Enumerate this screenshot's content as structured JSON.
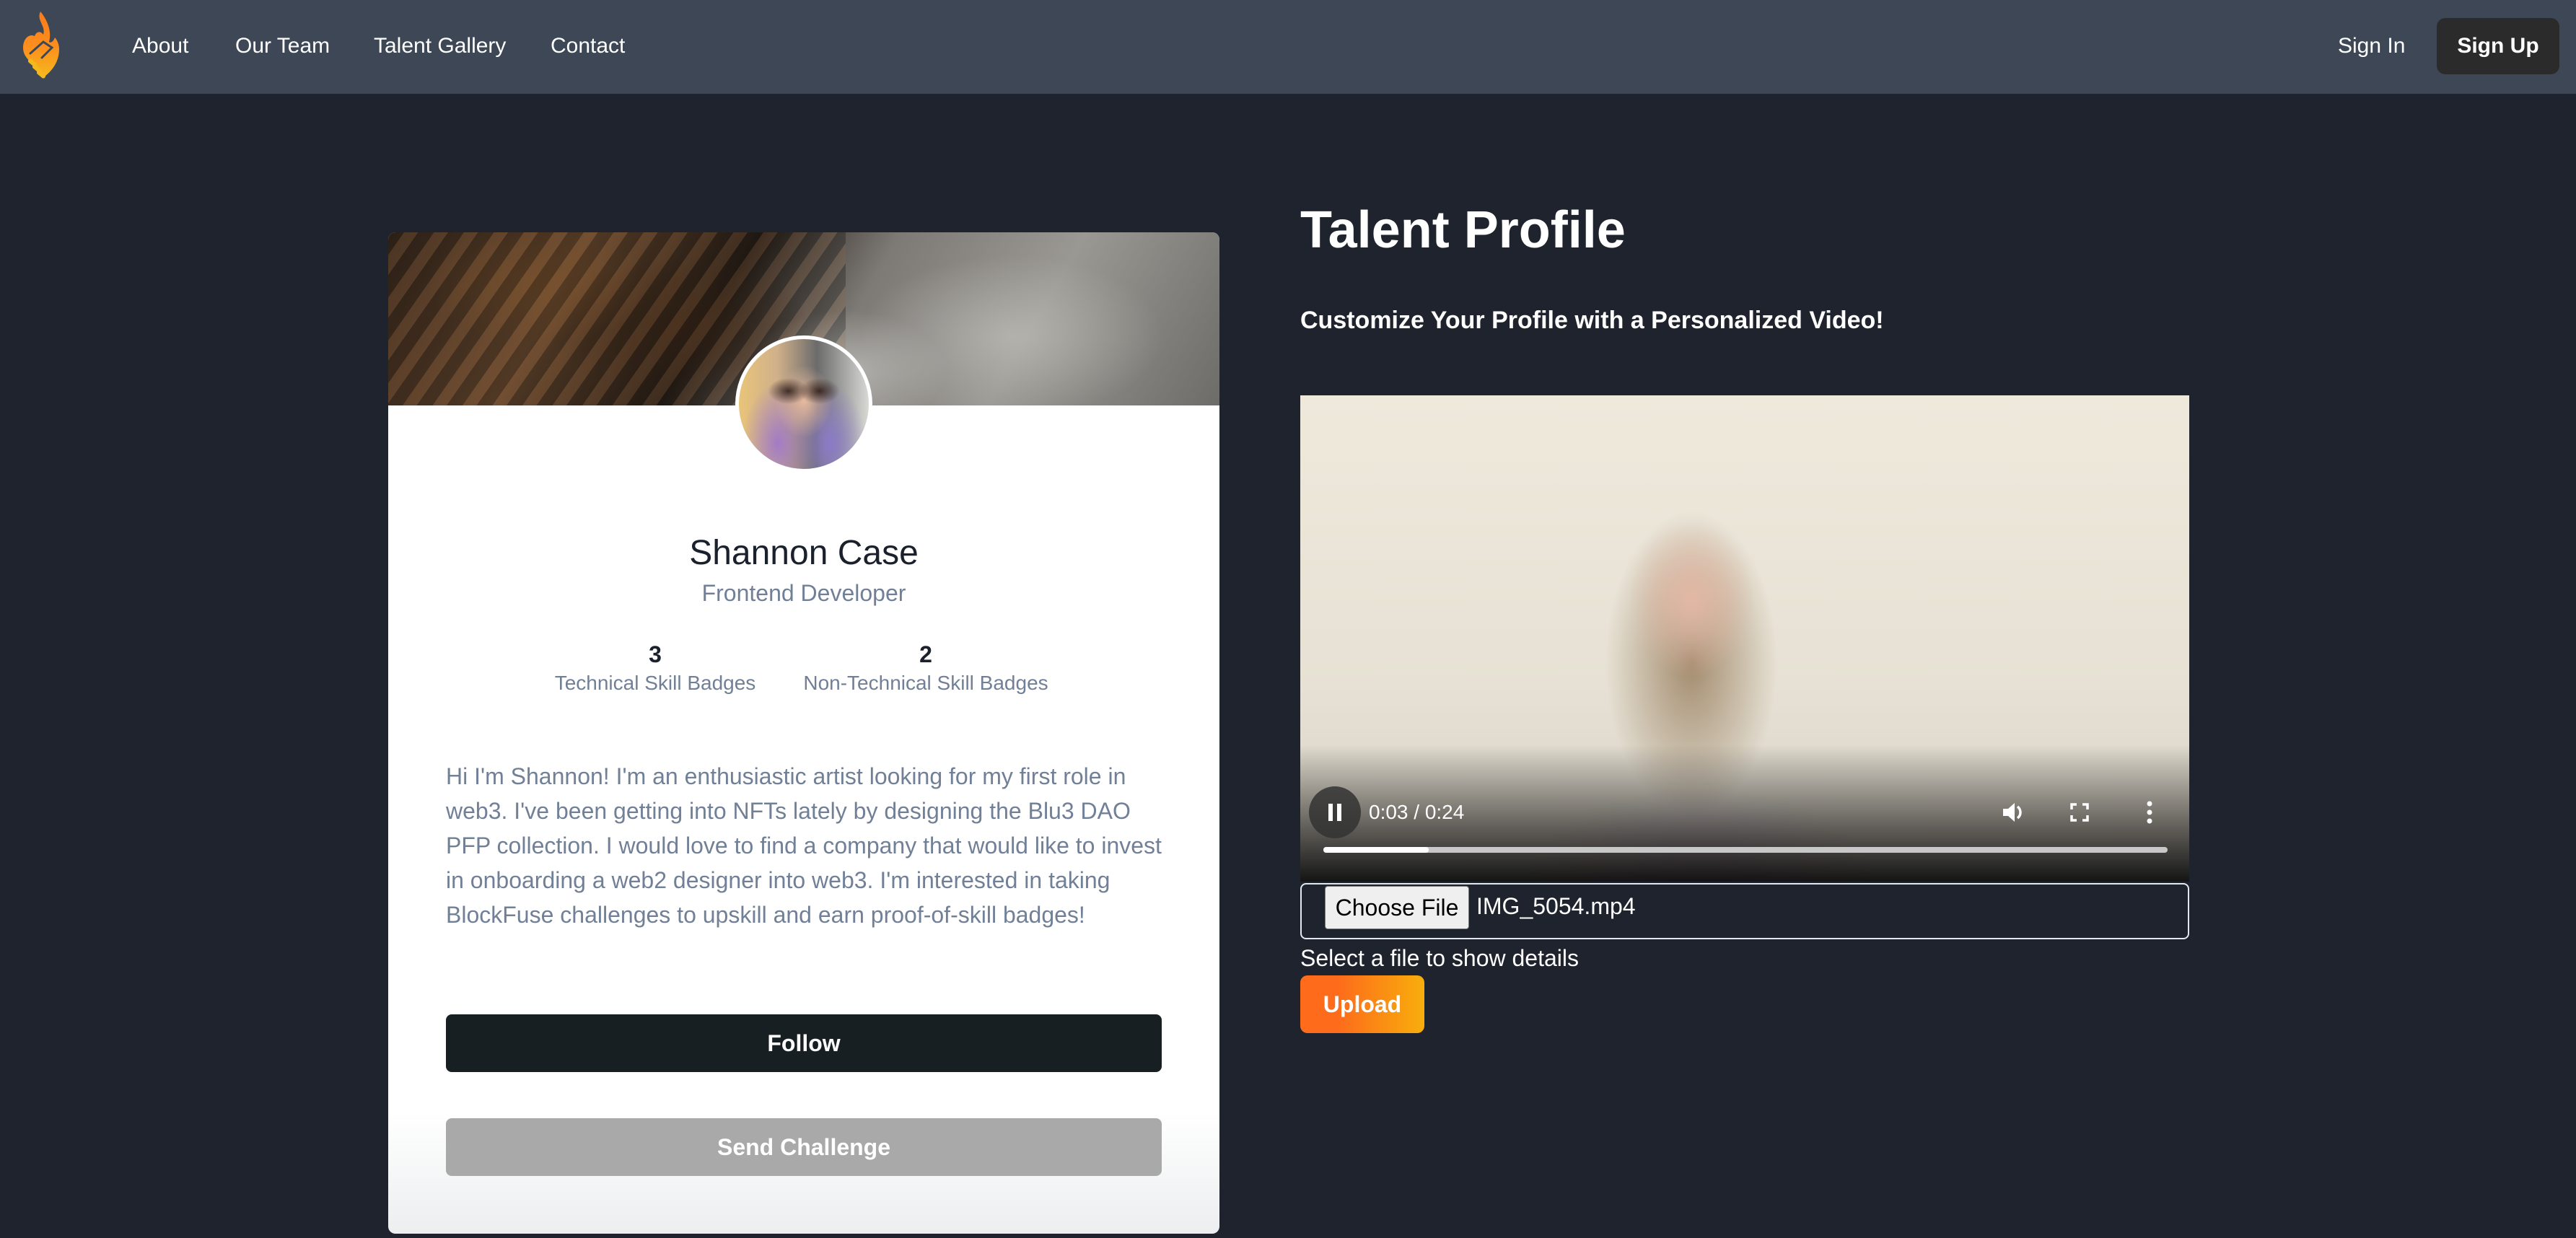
{
  "navbar": {
    "logo_icon": "flame-handshake-logo-icon",
    "links": [
      "About",
      "Our Team",
      "Talent Gallery",
      "Contact"
    ],
    "sign_in": "Sign In",
    "sign_up": "Sign Up"
  },
  "profile": {
    "name": "Shannon Case",
    "role": "Frontend Developer",
    "stats": [
      {
        "count": "3",
        "label": "Technical Skill Badges"
      },
      {
        "count": "2",
        "label": "Non-Technical Skill Badges"
      }
    ],
    "bio": "Hi I'm Shannon! I'm an enthusiastic artist looking for my first role in web3. I've been getting into NFTs lately by designing the Blu3 DAO PFP collection. I would love to find a company that would like to invest in onboarding a web2 designer into web3. I'm interested in taking BlockFuse challenges to upskill and earn proof-of-skill badges!",
    "follow_label": "Follow",
    "challenge_label": "Send Challenge"
  },
  "main": {
    "title": "Talent Profile",
    "subtitle": "Customize Your Profile with a Personalized Video!",
    "video": {
      "state": "playing",
      "current_time": "0:03",
      "duration": "0:24",
      "time_display": "0:03 / 0:24",
      "progress_fraction": 0.125
    },
    "file_input": {
      "button_label": "Choose File",
      "file_name": "IMG_5054.mp4"
    },
    "file_details": "Select a file to show details",
    "upload_label": "Upload"
  },
  "colors": {
    "navbar_bg": "#3d4756",
    "page_bg": "#1e232d",
    "follow_bg": "#181f22",
    "challenge_bg": "#a9a9a9",
    "upload_gradient_start": "#fd6b1b",
    "upload_gradient_end": "#f8ae0c",
    "muted_text": "#718096"
  }
}
